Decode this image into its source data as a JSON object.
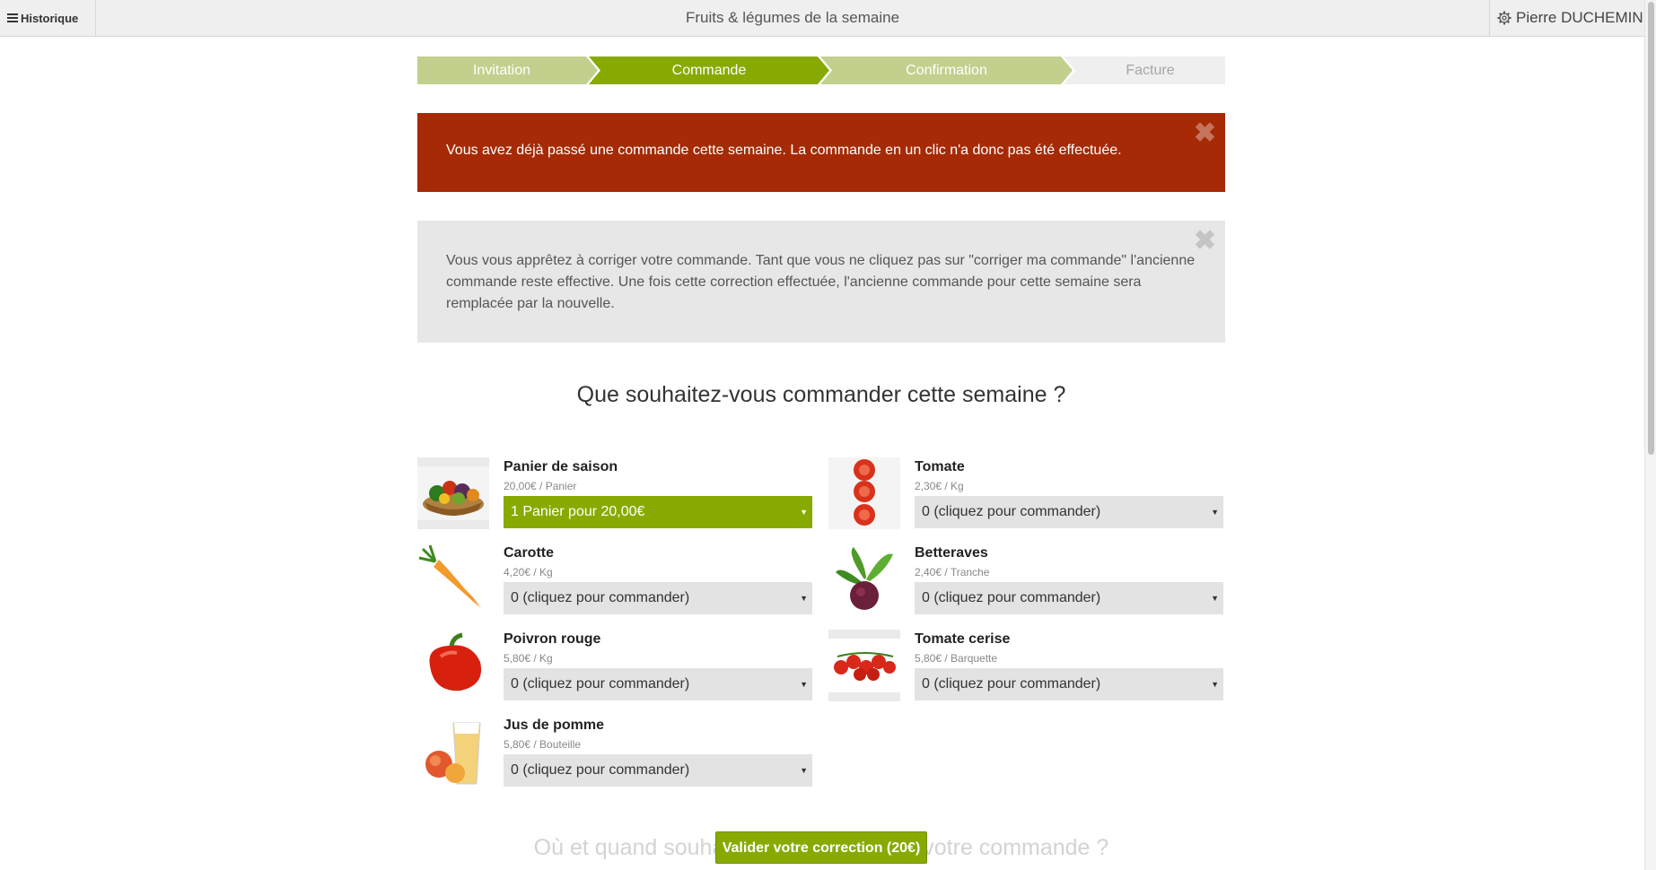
{
  "topbar": {
    "history_label": "Historique",
    "title": "Fruits & légumes de la semaine",
    "user_name": "Pierre DUCHEMIN"
  },
  "steps": [
    {
      "label": "Invitation",
      "state": "done"
    },
    {
      "label": "Commande",
      "state": "active"
    },
    {
      "label": "Confirmation",
      "state": "done"
    },
    {
      "label": "Facture",
      "state": "todo"
    }
  ],
  "alerts": {
    "error_text": "Vous avez déjà passé une commande cette semaine. La commande en un clic n'a donc pas été effectuée.",
    "info_text": "Vous vous apprêtez à corriger votre commande. Tant que vous ne cliquez pas sur \"corriger ma commande\" l'ancienne commande reste effective. Une fois cette correction effectuée, l'ancienne commande pour cette semaine sera remplacée par la nouvelle.",
    "close_symbol": "✖"
  },
  "question": "Que souhaitez-vous commander cette semaine ?",
  "products": [
    {
      "name": "Panier de saison",
      "price": "20,00€ / Panier",
      "selected": "1 Panier pour 20,00€",
      "icon": "basket-image"
    },
    {
      "name": "Tomate",
      "price": "2,30€ / Kg",
      "selected": "0 (cliquez pour commander)",
      "icon": "tomato-image"
    },
    {
      "name": "Carotte",
      "price": "4,20€ / Kg",
      "selected": "0 (cliquez pour commander)",
      "icon": "carrot-image"
    },
    {
      "name": "Betteraves",
      "price": "2,40€ / Tranche",
      "selected": "0 (cliquez pour commander)",
      "icon": "beet-image"
    },
    {
      "name": "Poivron rouge",
      "price": "5,80€ / Kg",
      "selected": "0 (cliquez pour commander)",
      "icon": "pepper-image"
    },
    {
      "name": "Tomate cerise",
      "price": "5,80€ / Barquette",
      "selected": "0 (cliquez pour commander)",
      "icon": "cherry-tomato-image"
    },
    {
      "name": "Jus de pomme",
      "price": "5,80€ / Bouteille",
      "selected": "0 (cliquez pour commander)",
      "icon": "apple-juice-image"
    }
  ],
  "bottom_question": "Où et quand souhaitez-vous récupérer votre commande ?",
  "validate_label": "Valider votre correction (20€)",
  "colors": {
    "accent": "#88aa00",
    "step_done": "#c1d08d",
    "error": "#a62a05",
    "info_bg": "#e7e7e7"
  }
}
